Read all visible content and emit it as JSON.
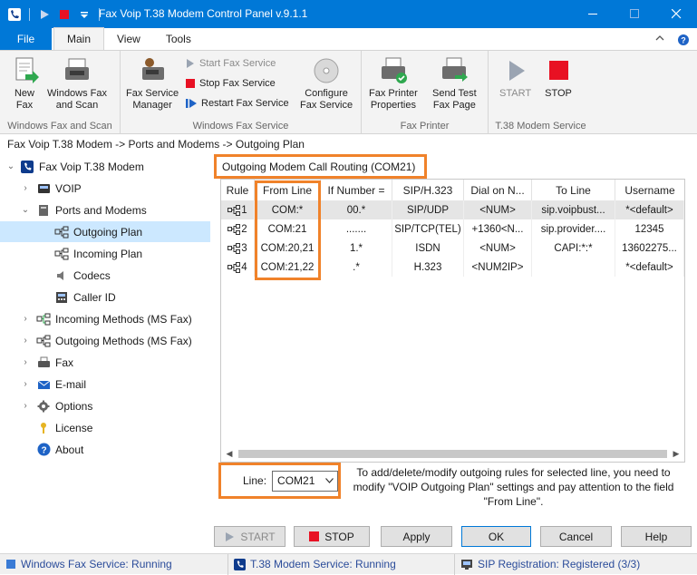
{
  "window": {
    "title": "Fax Voip T.38 Modem Control Panel v.9.1.1"
  },
  "ribbon_tabs": [
    {
      "label": "File"
    },
    {
      "label": "Main"
    },
    {
      "label": "View"
    },
    {
      "label": "Tools"
    }
  ],
  "ribbon": {
    "groups": [
      {
        "label": "Windows Fax and Scan",
        "buttons": [
          "New Fax",
          "Windows Fax and Scan"
        ]
      },
      {
        "label": "Windows Fax Service",
        "buttons": [
          "Fax Service Manager",
          "Configure Fax Service"
        ],
        "small_buttons": [
          "Start Fax Service",
          "Stop Fax Service",
          "Restart Fax Service"
        ]
      },
      {
        "label": "Fax Printer",
        "buttons": [
          "Fax Printer Properties",
          "Send Test Fax Page"
        ]
      },
      {
        "label": "T.38 Modem Service",
        "buttons": [
          "START",
          "STOP"
        ]
      }
    ],
    "btn_new_fax_1": "New",
    "btn_new_fax_2": "Fax",
    "btn_wfs_1": "Windows Fax",
    "btn_wfs_2": "and Scan",
    "btn_fsm_1": "Fax Service",
    "btn_fsm_2": "Manager",
    "btn_cfs_1": "Configure",
    "btn_cfs_2": "Fax Service",
    "btn_fpp_1": "Fax Printer",
    "btn_fpp_2": "Properties",
    "btn_stf_1": "Send Test",
    "btn_stf_2": "Fax Page",
    "btn_start": "START",
    "btn_stop": "STOP",
    "small_start": "Start Fax Service",
    "small_stop": "Stop Fax Service",
    "small_restart": "Restart Fax Service",
    "group1": "Windows Fax and Scan",
    "group2": "Windows Fax Service",
    "group3": "Fax Printer",
    "group4": "T.38 Modem Service"
  },
  "breadcrumb": "Fax Voip T.38 Modem -> Ports and Modems -> Outgoing Plan",
  "tree": [
    {
      "label": "Fax Voip T.38 Modem"
    },
    {
      "label": "VOIP"
    },
    {
      "label": "Ports and Modems"
    },
    {
      "label": "Outgoing Plan",
      "selected": true
    },
    {
      "label": "Incoming Plan"
    },
    {
      "label": "Codecs"
    },
    {
      "label": "Caller ID"
    },
    {
      "label": "Incoming Methods (MS Fax)"
    },
    {
      "label": "Outgoing Methods (MS Fax)"
    },
    {
      "label": "Fax"
    },
    {
      "label": "E-mail"
    },
    {
      "label": "Options"
    },
    {
      "label": "License"
    },
    {
      "label": "About"
    }
  ],
  "panel_title": "Outgoing Modem Call Routing (COM21)",
  "table": {
    "columns": [
      "Rule",
      "From Line",
      "If Number =",
      "SIP/H.323",
      "Dial on N...",
      "To Line",
      "Username"
    ],
    "rows": [
      [
        "1",
        "COM:*",
        "00.*",
        "SIP/UDP",
        "<NUM>",
        "sip.voipbust...",
        "*<default>"
      ],
      [
        "2",
        "COM:21",
        ".......",
        "SIP/TCP(TEL)",
        "+1360<N...",
        "sip.provider....",
        "12345"
      ],
      [
        "3",
        "COM:20,21",
        "1.*",
        "ISDN",
        "<NUM>",
        "CAPI:*:*",
        "13602275..."
      ],
      [
        "4",
        "COM:21,22",
        ".*",
        "H.323",
        "<NUM2IP>",
        "",
        "*<default>"
      ]
    ]
  },
  "line": {
    "label": "Line:",
    "value": "COM21"
  },
  "note": "To add/delete/modify outgoing rules for selected line, you need to modify \"VOIP Outgoing Plan\" settings and pay attention to the field \"From Line\".",
  "buttons": {
    "start": "START",
    "stop": "STOP",
    "apply": "Apply",
    "ok": "OK",
    "cancel": "Cancel",
    "help": "Help"
  },
  "status": {
    "fax_service": "Windows Fax Service: Running",
    "modem_service": "T.38 Modem Service: Running",
    "sip": "SIP Registration: Registered (3/3)"
  },
  "colors": {
    "accent": "#0078d7",
    "highlight": "#f0822a",
    "selection": "#cce8ff"
  }
}
